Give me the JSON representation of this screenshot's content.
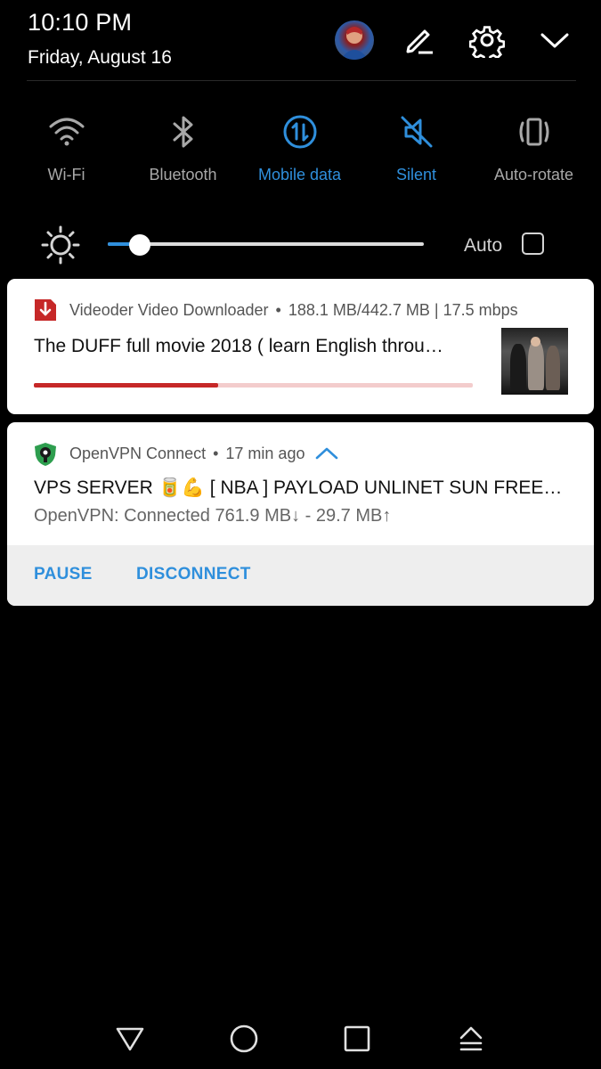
{
  "status": {
    "time": "10:10 PM",
    "date": "Friday, August 16"
  },
  "header_icons": [
    "avatar",
    "edit-icon",
    "settings-icon",
    "collapse-chevron-icon"
  ],
  "toggles": [
    {
      "label": "Wi-Fi",
      "icon": "wifi-icon",
      "active": false
    },
    {
      "label": "Bluetooth",
      "icon": "bluetooth-icon",
      "active": false
    },
    {
      "label": "Mobile data",
      "icon": "mobile-data-icon",
      "active": true
    },
    {
      "label": "Silent",
      "icon": "silent-icon",
      "active": true
    },
    {
      "label": "Auto-rotate",
      "icon": "auto-rotate-icon",
      "active": false
    }
  ],
  "brightness": {
    "level": 0.1,
    "auto_label": "Auto",
    "auto_checked": false
  },
  "notifications": [
    {
      "app": "Videoder Video Downloader",
      "meta": "188.1 MB/442.7 MB | 17.5 mbps",
      "title": "The DUFF full movie 2018  ( learn English throu…",
      "progress": 0.42,
      "icon": "download-icon"
    },
    {
      "app": "OpenVPN Connect",
      "meta": "17 min ago",
      "title": "VPS SERVER 🥫💪 [ NBA ] PAYLOAD UNLINET SUN FREEV…",
      "subtitle": "OpenVPN: Connected  761.9 MB↓  -  29.7 MB↑",
      "actions": [
        "PAUSE",
        "DISCONNECT"
      ],
      "icon": "vpn-shield-icon"
    }
  ],
  "colors": {
    "accent": "#2f8fdc",
    "progress": "#c62828",
    "background": "#000000",
    "card": "#ffffff"
  },
  "nav_icons": [
    "back-icon",
    "home-icon",
    "recents-icon",
    "notification-manager-icon"
  ]
}
